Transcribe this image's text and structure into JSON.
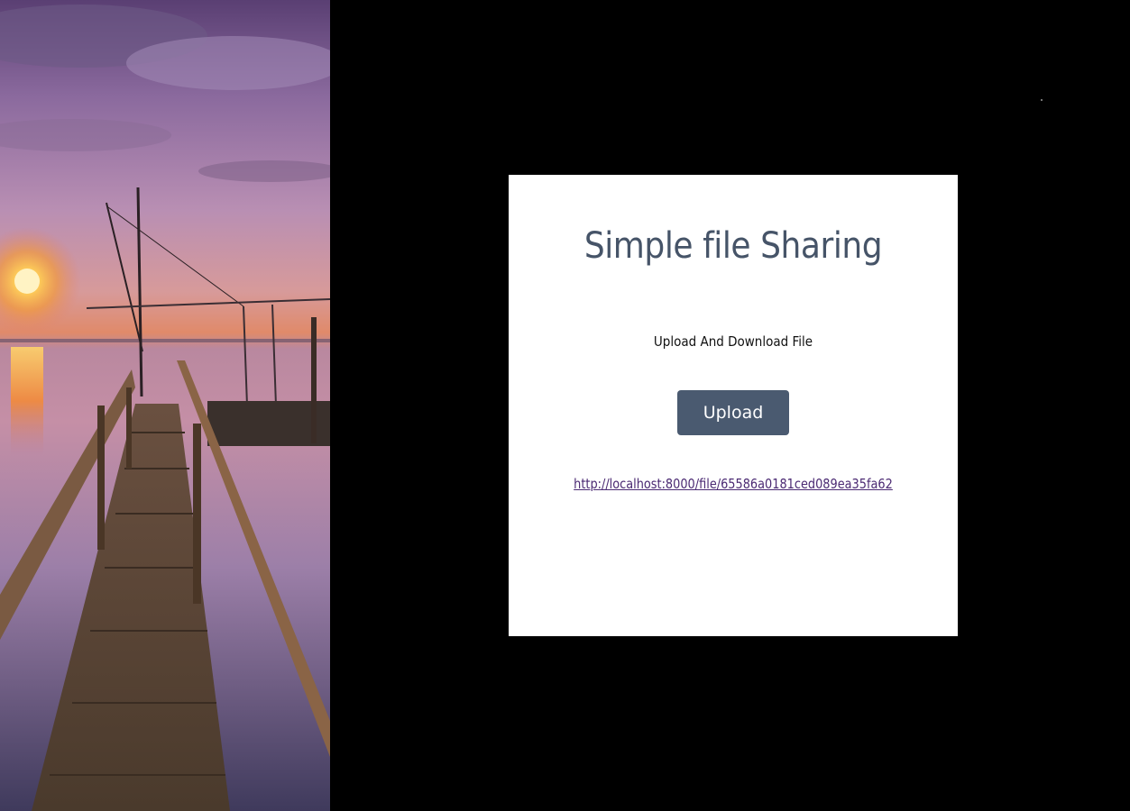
{
  "card": {
    "title": "Simple file Sharing",
    "subtitle": "Upload And Download File",
    "upload_label": "Upload",
    "file_link": "http://localhost:8000/file/65586a0181ced089ea35fa62"
  },
  "colors": {
    "background": "#000000",
    "card": "#ffffff",
    "title": "#465468",
    "button": "#4a5a70",
    "button_text": "#ffffff",
    "link": "#4b2a73"
  },
  "photo": {
    "icon": "sunset-pier-photo"
  }
}
